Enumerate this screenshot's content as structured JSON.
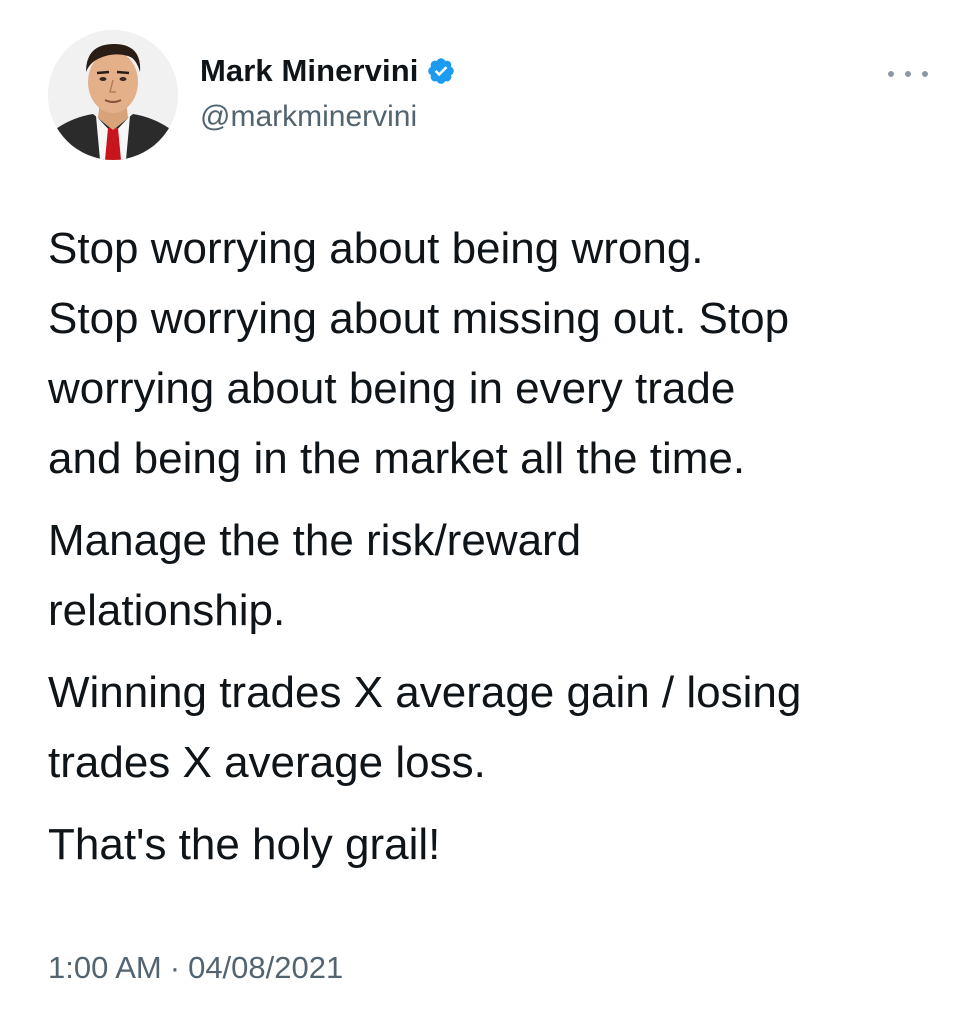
{
  "author": {
    "display_name": "Mark Minervini",
    "handle": "@markminervini",
    "verified": true
  },
  "tweet": {
    "paragraphs": [
      {
        "lines": [
          "Stop worrying about being wrong.",
          "Stop worrying about missing out. Stop",
          "worrying about being in every trade",
          "and being in the market all the time."
        ]
      },
      {
        "lines": [
          "Manage the the risk/reward",
          "relationship."
        ]
      },
      {
        "lines": [
          "Winning trades X average gain / losing",
          "trades X average loss."
        ]
      },
      {
        "lines": [
          "That's the holy grail!"
        ]
      }
    ]
  },
  "meta": {
    "time": "1:00 AM",
    "separator": "·",
    "date": "04/08/2021"
  },
  "icons": {
    "verified": "verified-badge-icon",
    "more": "more-options-icon"
  },
  "colors": {
    "text": "#0f1419",
    "secondary": "#536471",
    "verified_blue": "#1d9bf0"
  }
}
